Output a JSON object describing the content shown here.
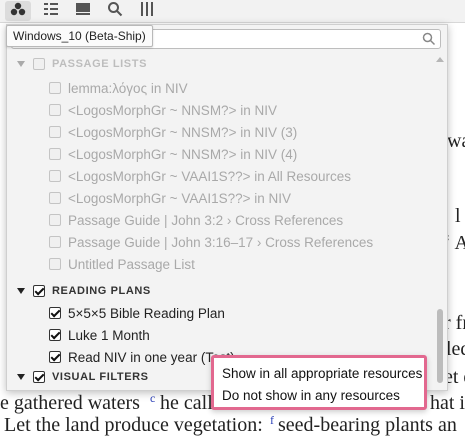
{
  "toolbar": {
    "tooltip": "Windows_10 (Beta-Ship)"
  },
  "search": {
    "value": "",
    "placeholder": ""
  },
  "sections": {
    "passage_lists": {
      "label": "PASSAGE LISTS",
      "items": [
        "lemma:λόγος in NIV",
        "<LogosMorphGr ~ NNSM?> in NIV",
        "<LogosMorphGr ~ NNSM?> in NIV (3)",
        "<LogosMorphGr ~ NNSM?> in NIV (4)",
        "<LogosMorphGr ~ VAAI1S??> in All Resources",
        "<LogosMorphGr ~ VAAI1S??> in NIV",
        "Passage Guide | John 3:2 › Cross References",
        "Passage Guide | John 3:16–17 › Cross References",
        "Untitled Passage List"
      ]
    },
    "reading_plans": {
      "label": "READING PLANS",
      "items": [
        "5×5×5 Bible Reading Plan",
        "Luke 1 Month",
        "Read NIV in one year (Test)"
      ]
    },
    "visual_filters": {
      "label": "VISUAL FILTERS"
    }
  },
  "context_menu": {
    "items": [
      "Show in all appropriate resources",
      "Do not show in any resources"
    ]
  },
  "document": {
    "fragments": {
      "wa": "wa",
      "l": "l",
      "an": "‘ An",
      "fr": "r fr",
      "led": "led",
      "let": "et d",
      "gathered": "e gathered waters",
      "he_call": "he call",
      "hat_it": "hat it",
      "land": "Let the land produce vegetation:",
      "seed": "seed-bearing plants an"
    },
    "marks": {
      "c": "c",
      "f": "f"
    }
  },
  "colors": {
    "menu_border": "#e2688f",
    "dropdown_button": "#3c4a63",
    "cross_ref_marker": "#2a3fb8"
  },
  "icons": [
    "resources-icon",
    "list-icon",
    "panel-icon",
    "search-icon",
    "columns-icon",
    "chevron-down-icon"
  ]
}
